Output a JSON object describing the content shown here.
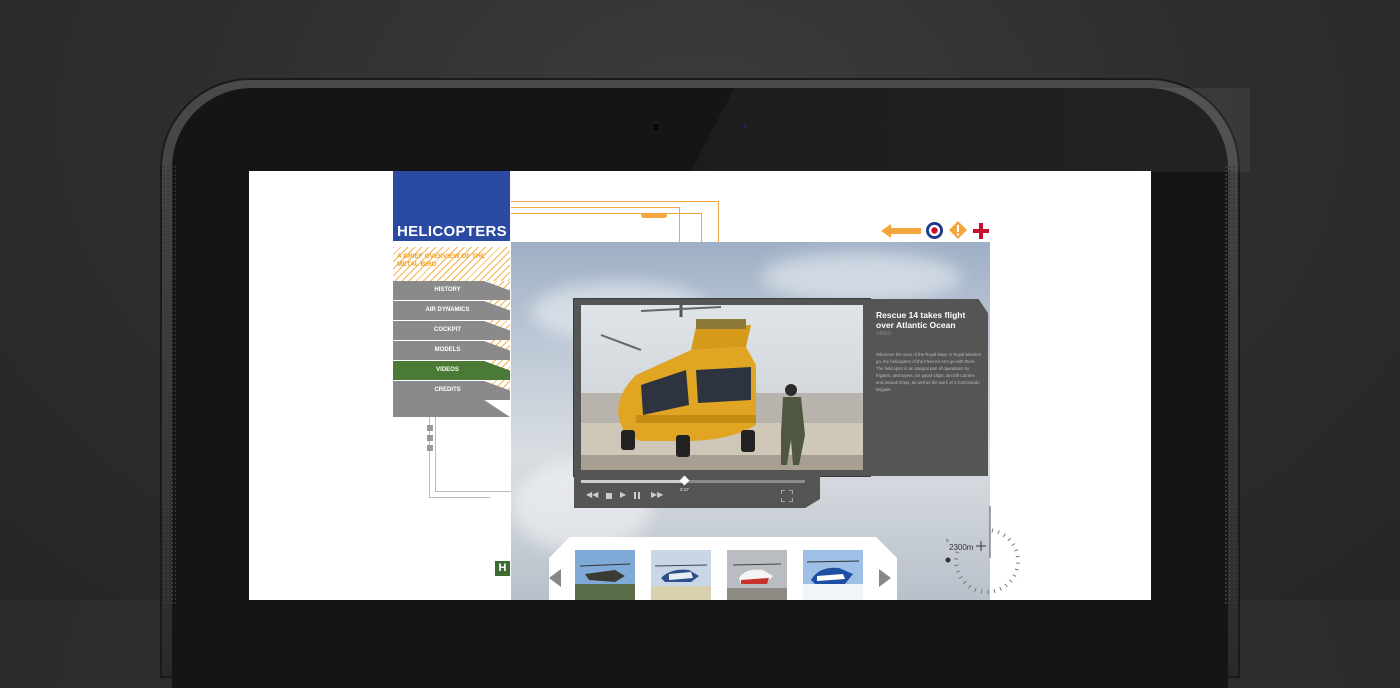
{
  "app": {
    "title": "HELICOPTERS",
    "subtitle": "A BRIEF OVERVIEW OF THE METAL BIRD"
  },
  "nav": {
    "items": [
      {
        "label": "HISTORY",
        "active": false
      },
      {
        "label": "AIR DYNAMICS",
        "active": false
      },
      {
        "label": "COCKPIT",
        "active": false
      },
      {
        "label": "MODELS",
        "active": false
      },
      {
        "label": "VIDEOS",
        "active": true
      },
      {
        "label": "CREDITS",
        "active": false
      }
    ]
  },
  "toolbar": {
    "icons": [
      "back-arrow-icon",
      "roundel-icon",
      "warning-icon",
      "add-icon"
    ]
  },
  "video": {
    "title": "Rescue 14 takes flight over Atlantic Ocean",
    "tag": "VIDEO",
    "body": "Wherever the sons of the Royal Navy or Royal Marines go, the helicopters of the Fleet Air Arm go with them. The helicopter is an integral part of operations by frigates, destroyers, ice patrol ships, aircraft carriers and assault ships, as well as the work of 3 Commando Brigade.",
    "time": "2:17",
    "progress": 0.46
  },
  "section_badge": "H",
  "altimeter": {
    "value": "2300m",
    "marker": "0"
  },
  "thumbnails": [
    "attack-helicopter",
    "blue-white-helicopter",
    "red-white-helicopter",
    "blue-helicopter-snow"
  ],
  "colors": {
    "brand_blue": "#2b4aa3",
    "accent_orange": "#f2a640",
    "active_green": "#4b7a36",
    "nav_gray": "#8a8a8a"
  }
}
